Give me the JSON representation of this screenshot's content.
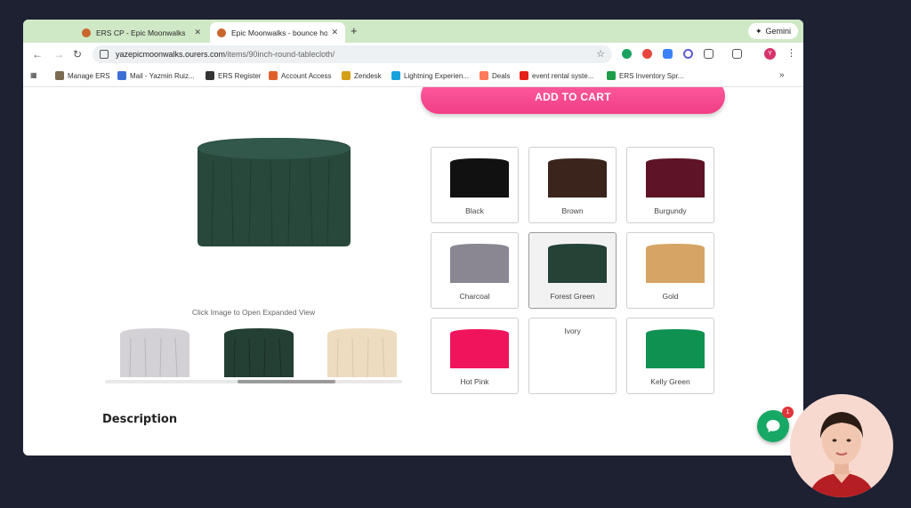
{
  "browser": {
    "tabs": [
      {
        "title": "ERS CP - Epic Moonwalks"
      },
      {
        "title": "Epic Moonwalks - bounce ho"
      }
    ],
    "new_tab": "+",
    "gemini": "Gemini",
    "url_host": "yazepicmoonwalks.ourers.com",
    "url_path": "/items/90inch-round-tablecloth/",
    "profile_initial": "Y"
  },
  "bookmarks": [
    {
      "label": "Manage ERS",
      "color": "#7a6a4f"
    },
    {
      "label": "Mail - Yazmin Ruiz...",
      "color": "#3b6fd4"
    },
    {
      "label": "ERS Register",
      "color": "#333333"
    },
    {
      "label": "Account Access",
      "color": "#e0602b"
    },
    {
      "label": "Zendesk",
      "color": "#d4a017"
    },
    {
      "label": "Lightning Experien...",
      "color": "#19a1dd"
    },
    {
      "label": "Deals",
      "color": "#ff7a59"
    },
    {
      "label": "event rental syste...",
      "color": "#e62117"
    },
    {
      "label": "ERS Inventory Spr...",
      "color": "#1e9e4a"
    }
  ],
  "page": {
    "add_to_cart": "ADD TO CART",
    "hint": "Click Image to Open Expanded View",
    "description_heading": "Description",
    "selected_color": "Forest Green",
    "thumbnails": [
      {
        "color": "#d3d1d6"
      },
      {
        "color": "#243f33"
      },
      {
        "color": "#eedcc0"
      }
    ],
    "swatches": [
      {
        "label": "Black",
        "color": "#111111"
      },
      {
        "label": "Brown",
        "color": "#3a241c"
      },
      {
        "label": "Burgundy",
        "color": "#5e1426"
      },
      {
        "label": "Charcoal",
        "color": "#8a8692"
      },
      {
        "label": "Forest Green",
        "color": "#244236"
      },
      {
        "label": "Gold",
        "color": "#d6a464"
      },
      {
        "label": "Hot Pink",
        "color": "#f0145c"
      },
      {
        "label": "Ivory",
        "color": ""
      },
      {
        "label": "Kelly Green",
        "color": "#0f9152"
      }
    ]
  },
  "chat": {
    "badge": "1"
  }
}
